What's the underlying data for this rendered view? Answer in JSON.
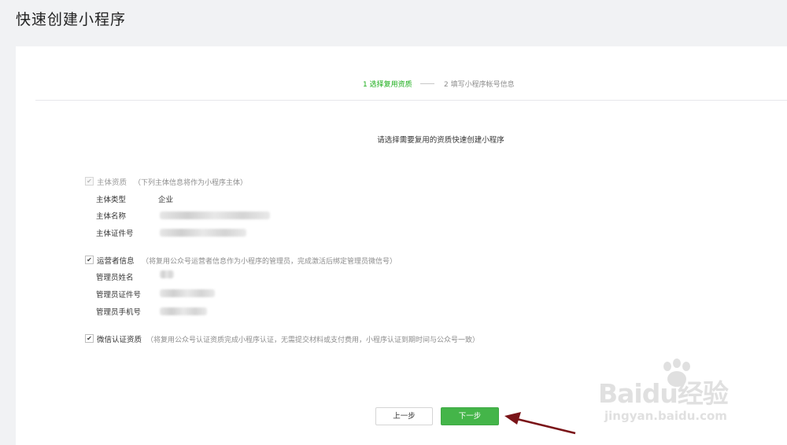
{
  "page": {
    "title": "快速创建小程序"
  },
  "steps": {
    "step1": "1 选择复用资质",
    "step2": "2 填写小程序帐号信息",
    "active_color": "#1aad19"
  },
  "instruction": "请选择需要复用的资质快速创建小程序",
  "sections": {
    "entity": {
      "checked": true,
      "disabled": true,
      "label": "主体资质",
      "note": "（下列主体信息将作为小程序主体）",
      "fields": {
        "type_label": "主体类型",
        "type_value": "企业",
        "name_label": "主体名称",
        "cert_label": "主体证件号"
      }
    },
    "operator": {
      "checked": true,
      "label": "运营者信息",
      "note": "（将复用公众号运营者信息作为小程序的管理员，完成激活后绑定管理员微信号）",
      "fields": {
        "name_label": "管理员姓名",
        "id_label": "管理员证件号",
        "phone_label": "管理员手机号"
      }
    },
    "wechat_verify": {
      "checked": true,
      "label": "微信认证资质",
      "note": "（将复用公众号认证资质完成小程序认证，无需提交材料或支付费用，小程序认证到期时间与公众号一致）"
    }
  },
  "buttons": {
    "prev": "上一步",
    "next": "下一步",
    "next_color": "#44b549"
  },
  "watermark": {
    "logo": "Baidu经验",
    "sub": "jingyan.baidu.com"
  },
  "annotation_arrow_color": "#7a1418"
}
